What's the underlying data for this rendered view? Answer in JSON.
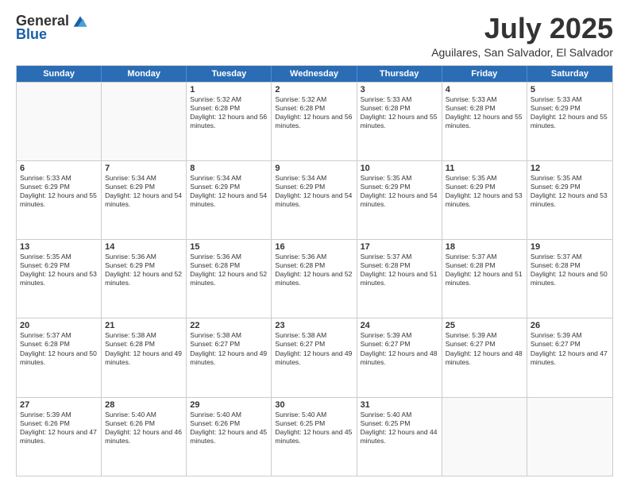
{
  "logo": {
    "general": "General",
    "blue": "Blue"
  },
  "title": "July 2025",
  "subtitle": "Aguilares, San Salvador, El Salvador",
  "days": [
    "Sunday",
    "Monday",
    "Tuesday",
    "Wednesday",
    "Thursday",
    "Friday",
    "Saturday"
  ],
  "rows": [
    [
      {
        "day": "",
        "empty": true
      },
      {
        "day": "",
        "empty": true
      },
      {
        "day": "1",
        "rise": "5:32 AM",
        "set": "6:28 PM",
        "daylight": "12 hours and 56 minutes."
      },
      {
        "day": "2",
        "rise": "5:32 AM",
        "set": "6:28 PM",
        "daylight": "12 hours and 56 minutes."
      },
      {
        "day": "3",
        "rise": "5:33 AM",
        "set": "6:28 PM",
        "daylight": "12 hours and 55 minutes."
      },
      {
        "day": "4",
        "rise": "5:33 AM",
        "set": "6:28 PM",
        "daylight": "12 hours and 55 minutes."
      },
      {
        "day": "5",
        "rise": "5:33 AM",
        "set": "6:29 PM",
        "daylight": "12 hours and 55 minutes."
      }
    ],
    [
      {
        "day": "6",
        "rise": "5:33 AM",
        "set": "6:29 PM",
        "daylight": "12 hours and 55 minutes."
      },
      {
        "day": "7",
        "rise": "5:34 AM",
        "set": "6:29 PM",
        "daylight": "12 hours and 54 minutes."
      },
      {
        "day": "8",
        "rise": "5:34 AM",
        "set": "6:29 PM",
        "daylight": "12 hours and 54 minutes."
      },
      {
        "day": "9",
        "rise": "5:34 AM",
        "set": "6:29 PM",
        "daylight": "12 hours and 54 minutes."
      },
      {
        "day": "10",
        "rise": "5:35 AM",
        "set": "6:29 PM",
        "daylight": "12 hours and 54 minutes."
      },
      {
        "day": "11",
        "rise": "5:35 AM",
        "set": "6:29 PM",
        "daylight": "12 hours and 53 minutes."
      },
      {
        "day": "12",
        "rise": "5:35 AM",
        "set": "6:29 PM",
        "daylight": "12 hours and 53 minutes."
      }
    ],
    [
      {
        "day": "13",
        "rise": "5:35 AM",
        "set": "6:29 PM",
        "daylight": "12 hours and 53 minutes."
      },
      {
        "day": "14",
        "rise": "5:36 AM",
        "set": "6:29 PM",
        "daylight": "12 hours and 52 minutes."
      },
      {
        "day": "15",
        "rise": "5:36 AM",
        "set": "6:28 PM",
        "daylight": "12 hours and 52 minutes."
      },
      {
        "day": "16",
        "rise": "5:36 AM",
        "set": "6:28 PM",
        "daylight": "12 hours and 52 minutes."
      },
      {
        "day": "17",
        "rise": "5:37 AM",
        "set": "6:28 PM",
        "daylight": "12 hours and 51 minutes."
      },
      {
        "day": "18",
        "rise": "5:37 AM",
        "set": "6:28 PM",
        "daylight": "12 hours and 51 minutes."
      },
      {
        "day": "19",
        "rise": "5:37 AM",
        "set": "6:28 PM",
        "daylight": "12 hours and 50 minutes."
      }
    ],
    [
      {
        "day": "20",
        "rise": "5:37 AM",
        "set": "6:28 PM",
        "daylight": "12 hours and 50 minutes."
      },
      {
        "day": "21",
        "rise": "5:38 AM",
        "set": "6:28 PM",
        "daylight": "12 hours and 49 minutes."
      },
      {
        "day": "22",
        "rise": "5:38 AM",
        "set": "6:27 PM",
        "daylight": "12 hours and 49 minutes."
      },
      {
        "day": "23",
        "rise": "5:38 AM",
        "set": "6:27 PM",
        "daylight": "12 hours and 49 minutes."
      },
      {
        "day": "24",
        "rise": "5:39 AM",
        "set": "6:27 PM",
        "daylight": "12 hours and 48 minutes."
      },
      {
        "day": "25",
        "rise": "5:39 AM",
        "set": "6:27 PM",
        "daylight": "12 hours and 48 minutes."
      },
      {
        "day": "26",
        "rise": "5:39 AM",
        "set": "6:27 PM",
        "daylight": "12 hours and 47 minutes."
      }
    ],
    [
      {
        "day": "27",
        "rise": "5:39 AM",
        "set": "6:26 PM",
        "daylight": "12 hours and 47 minutes."
      },
      {
        "day": "28",
        "rise": "5:40 AM",
        "set": "6:26 PM",
        "daylight": "12 hours and 46 minutes."
      },
      {
        "day": "29",
        "rise": "5:40 AM",
        "set": "6:26 PM",
        "daylight": "12 hours and 45 minutes."
      },
      {
        "day": "30",
        "rise": "5:40 AM",
        "set": "6:25 PM",
        "daylight": "12 hours and 45 minutes."
      },
      {
        "day": "31",
        "rise": "5:40 AM",
        "set": "6:25 PM",
        "daylight": "12 hours and 44 minutes."
      },
      {
        "day": "",
        "empty": true
      },
      {
        "day": "",
        "empty": true
      }
    ]
  ]
}
